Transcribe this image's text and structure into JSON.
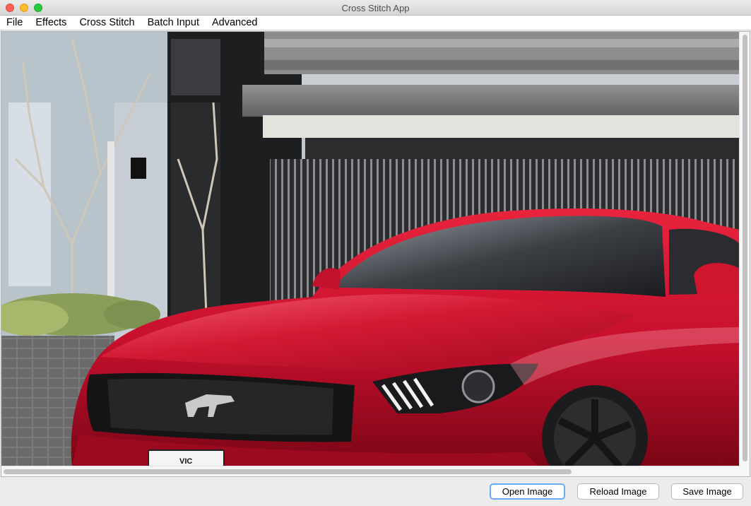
{
  "window": {
    "title": "Cross Stitch App"
  },
  "menu": {
    "items": [
      {
        "label": "File"
      },
      {
        "label": "Effects"
      },
      {
        "label": "Cross Stitch"
      },
      {
        "label": "Batch Input"
      },
      {
        "label": "Advanced"
      }
    ]
  },
  "image": {
    "description_icon": "photo-of-red-mustang",
    "plate_text": "VIC",
    "colors": {
      "car": "#c8102e",
      "sky": "#d8dde3",
      "building": "#3a3b3d",
      "ground": "#6c6c6c"
    }
  },
  "buttons": {
    "open": "Open Image",
    "reload": "Reload Image",
    "save": "Save Image"
  }
}
